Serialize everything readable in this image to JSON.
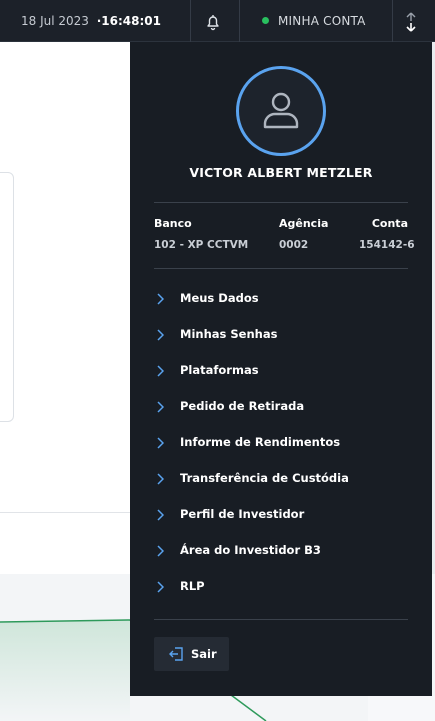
{
  "topbar": {
    "date": "18 Jul 2023",
    "time": "·16:48:01",
    "account_label": "MINHA CONTA",
    "status_color": "#29c05f"
  },
  "panel": {
    "user_name": "VICTOR ALBERT METZLER",
    "bank": {
      "labels": {
        "bank": "Banco",
        "agency": "Agência",
        "account": "Conta"
      },
      "values": {
        "bank": "102 - XP CCTVM",
        "agency": "0002",
        "account": "154142-6"
      }
    },
    "menu": [
      {
        "label": "Meus Dados"
      },
      {
        "label": "Minhas Senhas"
      },
      {
        "label": "Plataformas"
      },
      {
        "label": "Pedido de Retirada"
      },
      {
        "label": "Informe de Rendimentos"
      },
      {
        "label": "Transferência de Custódia"
      },
      {
        "label": "Perfil de Investidor"
      },
      {
        "label": "Área do Investidor B3"
      },
      {
        "label": "RLP"
      }
    ],
    "logout_label": "Sair",
    "accent_color": "#5aa3ef"
  }
}
